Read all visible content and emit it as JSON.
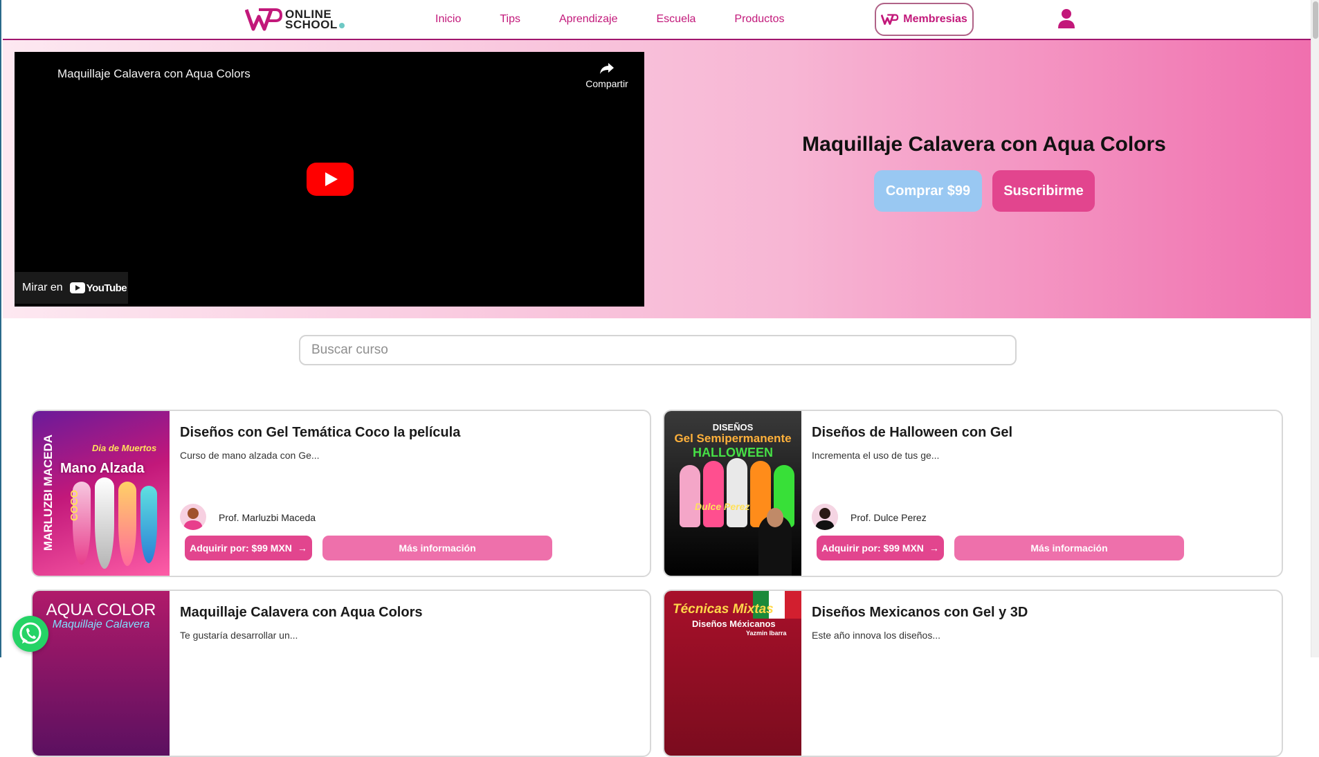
{
  "navbar": {
    "logo": "ONLINE SCHOOL",
    "logo_line1": "ONLINE",
    "logo_line2": "SCHOOL",
    "links": [
      "Inicio",
      "Tips",
      "Aprendizaje",
      "Escuela",
      "Productos"
    ],
    "membership_label": "Membresias"
  },
  "hero": {
    "video": {
      "title": "Maquillaje Calavera con Aqua Colors",
      "share_label": "Compartir",
      "watch_on_label": "Mirar en",
      "youtube_label": "YouTube"
    },
    "title": "Maquillaje Calavera con Aqua Colors",
    "buy_label": "Comprar $99",
    "subscribe_label": "Suscribirme"
  },
  "search": {
    "placeholder": "Buscar curso"
  },
  "courses": [
    {
      "title": "Diseños con Gel Temática Coco la película",
      "description": "Curso de mano alzada con Ge...",
      "teacher": "Prof. Marluzbi Maceda",
      "buy_label": "Adquirir por: $99 MXN",
      "more_label": "Más información",
      "thumb_text": [
        "MARLUZBI MACEDA",
        "Mano Alzada",
        "Dia de Muertos",
        "COCO"
      ]
    },
    {
      "title": "Diseños de Halloween con Gel",
      "description": "Incrementa el uso de tus ge...",
      "teacher": "Prof. Dulce Perez",
      "buy_label": "Adquirir por: $99 MXN",
      "more_label": "Más información",
      "thumb_text": [
        "DISEÑOS",
        "Gel Semipermanente",
        "HALLOWEEN",
        "Dulce Perez"
      ]
    },
    {
      "title": "Maquillaje Calavera con Aqua Colors",
      "description": "Te gustaría desarrollar un...",
      "thumb_text": [
        "AQUA COLOR",
        "Maquillaje Calavera"
      ]
    },
    {
      "title": "Diseños Mexicanos con Gel y 3D",
      "description": "Este año innova los diseños...",
      "thumb_text": [
        "Técnicas Mixtas",
        "Diseños Méxicanos",
        "Yazmin Ibarra"
      ]
    }
  ],
  "colors": {
    "brand": "#c2187a",
    "accent_pink": "#e2458e",
    "light_pink": "#ee70ab",
    "buy_blue": "#99c8f2",
    "whatsapp": "#25d366"
  },
  "icons": [
    "logo-icon",
    "user-icon",
    "share-icon",
    "play-icon",
    "youtube-icon",
    "arrow-right-icon",
    "whatsapp-icon"
  ]
}
